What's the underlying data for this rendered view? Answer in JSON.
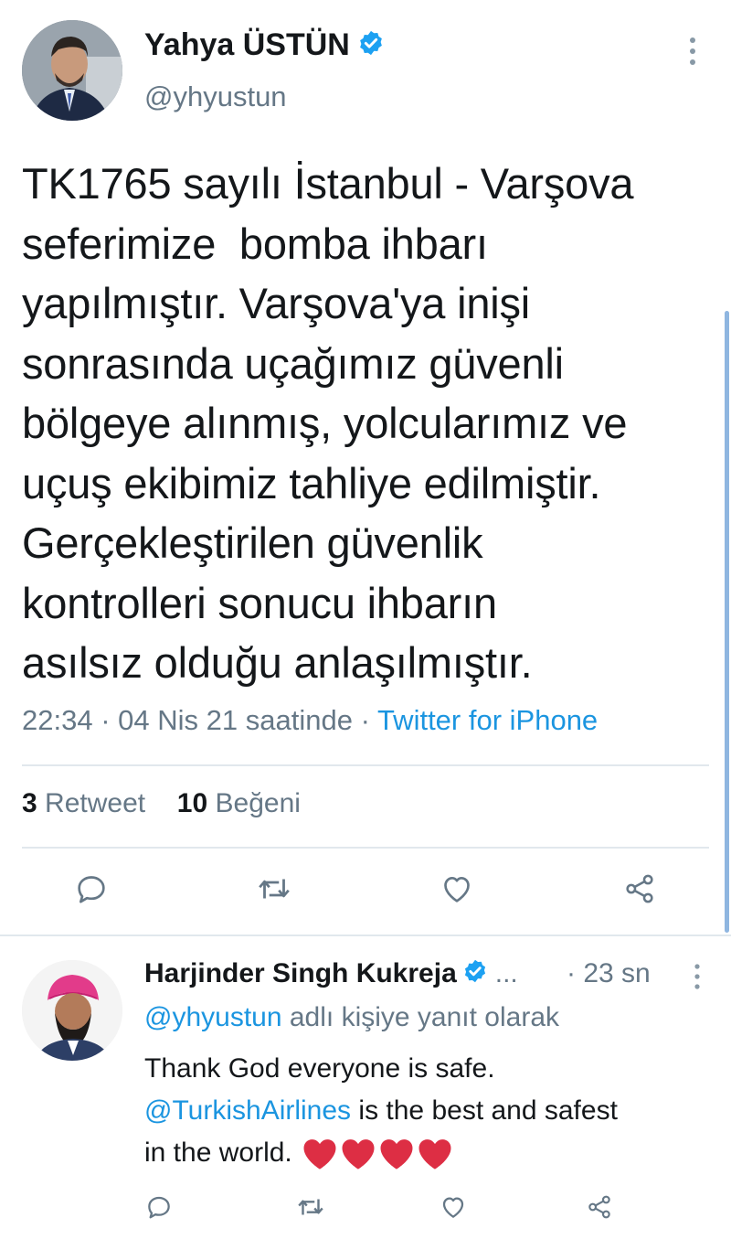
{
  "main_tweet": {
    "author_name": "Yahya ÜSTÜN",
    "handle": "@yhyustun",
    "text_lines": [
      "TK1765 sayılı İstanbul - Varşova",
      "seferimize  bomba ihbarı",
      "yapılmıştır. Varşova'ya inişi",
      "sonrasında uçağımız güvenli",
      "bölgeye alınmış, yolcularımız ve",
      "uçuş ekibimiz tahliye edilmiştir.",
      "Gerçekleştirilen güvenlik",
      "kontrolleri sonucu ihbarın",
      "asılsız olduğu anlaşılmıştır."
    ],
    "time": "22:34",
    "date": "04 Nis 21 saatinde",
    "separator": "·",
    "source": "Twitter for iPhone",
    "retweet_count": "3",
    "retweet_label": "Retweet",
    "like_count": "10",
    "like_label": "Beğeni"
  },
  "reply": {
    "author_name": "Harjinder Singh Kukreja",
    "ellipsis": "...",
    "time": "· 23 sn",
    "replying_handle": "@yhyustun",
    "replying_text": "adlı kişiye yanıt olarak",
    "line1": "Thank God everyone is safe.",
    "mention": "@TurkishAirlines",
    "line2_rest": "is the best and safest",
    "line3": "in the world."
  },
  "icons": {
    "verified": "verified-badge-icon",
    "more": "more-vertical-icon",
    "reply": "reply-icon",
    "retweet": "retweet-icon",
    "like": "like-heart-icon",
    "share": "share-icon",
    "emoji_heart": "red-heart-emoji"
  },
  "colors": {
    "text": "#14171a",
    "secondary": "#657786",
    "link": "#1b95e0",
    "verified": "#1da1f2",
    "heart_emoji": "#dd2e44"
  }
}
